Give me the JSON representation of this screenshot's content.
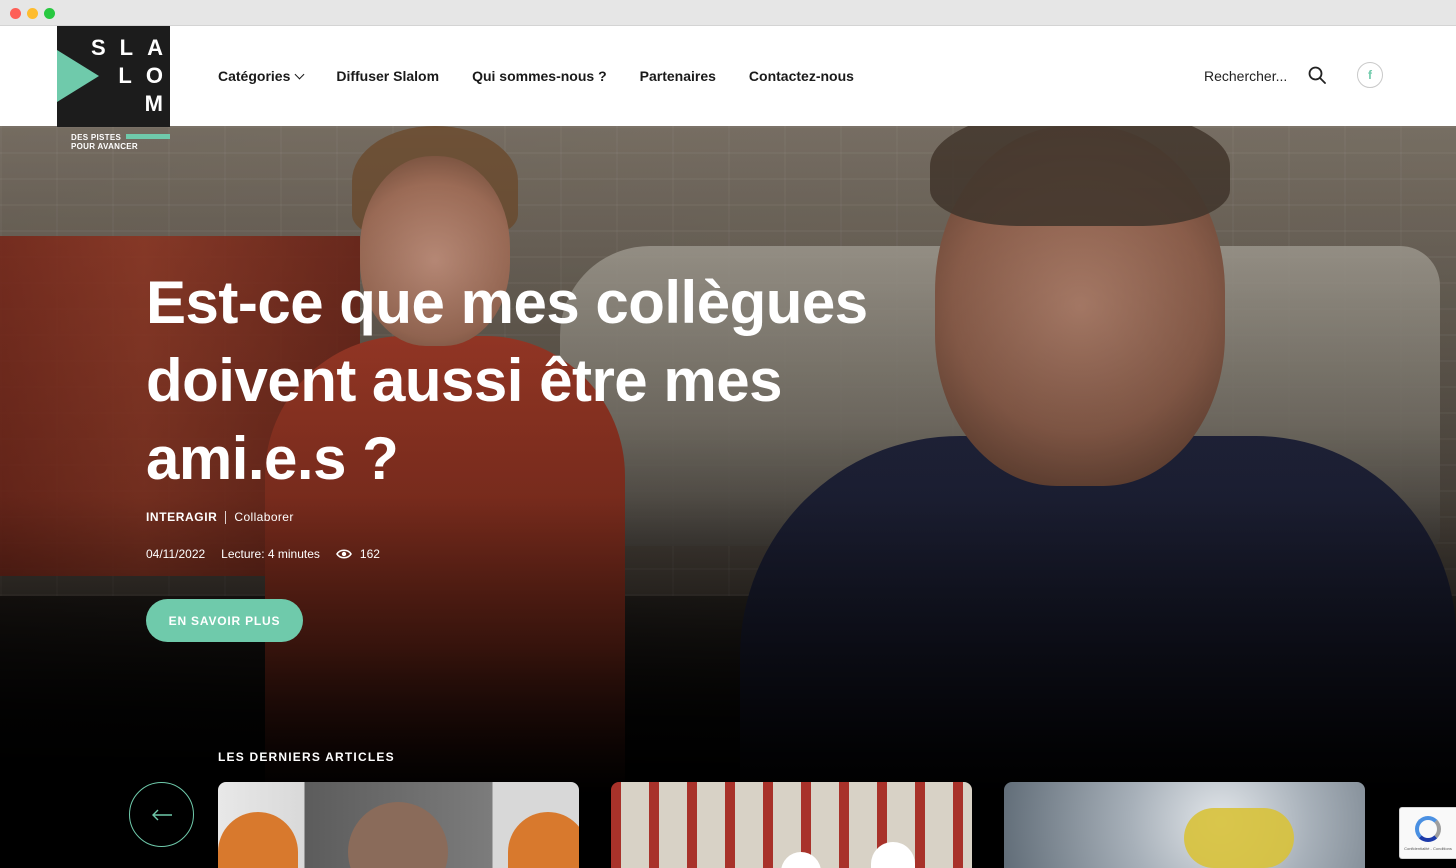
{
  "header": {
    "logo": {
      "letters": [
        "S",
        "L",
        "A",
        "L",
        "O",
        "M"
      ],
      "tagline_line1": "DES PISTES",
      "tagline_line2": "POUR AVANCER"
    },
    "nav": [
      {
        "label": "Catégories",
        "has_dropdown": true
      },
      {
        "label": "Diffuser Slalom"
      },
      {
        "label": "Qui sommes-nous ?"
      },
      {
        "label": "Partenaires"
      },
      {
        "label": "Contactez-nous"
      }
    ],
    "search_placeholder": "Rechercher...",
    "social": {
      "facebook_glyph": "f",
      "icon": "facebook-icon"
    }
  },
  "hero": {
    "title": "Est-ce que mes collègues doivent aussi être mes ami.e.s ?",
    "category": "INTERAGIR",
    "subcategory": "Collaborer",
    "date": "04/11/2022",
    "reading_time": "Lecture: 4 minutes",
    "views": "162",
    "cta_label": "EN SAVOIR PLUS"
  },
  "latest": {
    "title": "LES DERNIERS ARTICLES",
    "prev_icon": "arrow-left-icon"
  },
  "recaptcha": {
    "text": "Confidentialité - Conditions"
  },
  "colors": {
    "accent": "#6fcaab",
    "logo_bg": "#1c1c1c",
    "header_bg": "#ffffff"
  }
}
